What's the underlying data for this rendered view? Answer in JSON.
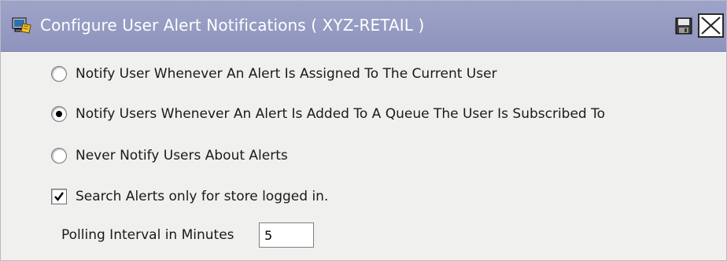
{
  "header": {
    "title": "Configure User Alert Notifications ( XYZ-RETAIL )",
    "icons": [
      "configure-icon",
      "save-icon",
      "close-icon"
    ]
  },
  "options": [
    {
      "label": "Notify User Whenever An Alert Is Assigned To The Current User",
      "selected": false
    },
    {
      "label": "Notify Users Whenever An Alert Is Added To A Queue The User Is Subscribed To",
      "selected": true
    },
    {
      "label": "Never Notify Users About Alerts",
      "selected": false
    }
  ],
  "store_search": {
    "label": "Search Alerts only for store logged in.",
    "checked": true
  },
  "polling": {
    "label": "Polling Interval in Minutes",
    "value": "5"
  },
  "colors": {
    "title_bar": "#969bc3",
    "title_text": "#ffffff",
    "panel_bg": "#f0f0ef"
  }
}
